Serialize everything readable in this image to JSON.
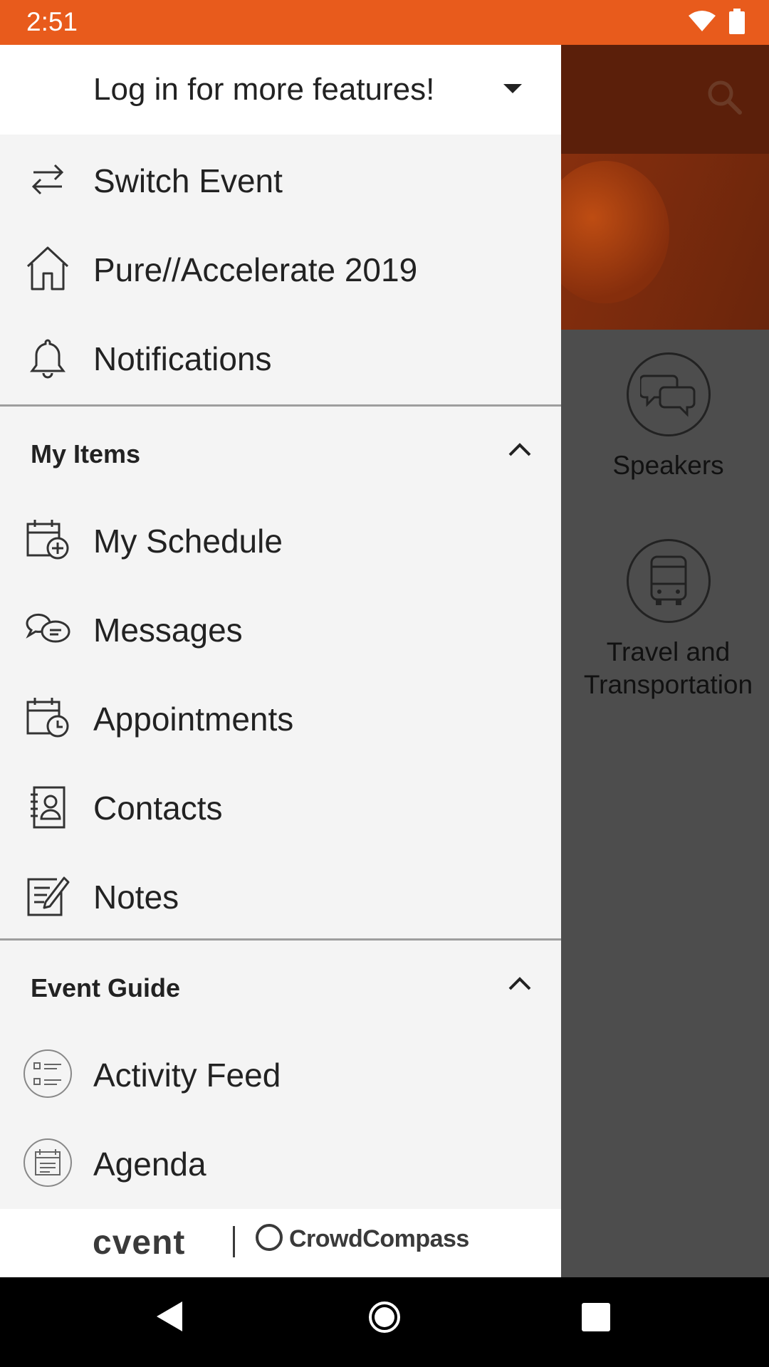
{
  "status_bar": {
    "time": "2:51"
  },
  "drawer": {
    "header_title": "Log in for more features!",
    "top_items": [
      {
        "label": "Switch Event",
        "icon": "switch-arrows-icon"
      },
      {
        "label": "Pure//Accelerate 2019",
        "icon": "home-icon"
      },
      {
        "label": "Notifications",
        "icon": "bell-icon"
      }
    ],
    "sections": [
      {
        "title": "My Items",
        "items": [
          {
            "label": "My Schedule",
            "icon": "calendar-add-icon"
          },
          {
            "label": "Messages",
            "icon": "chat-bubbles-icon"
          },
          {
            "label": "Appointments",
            "icon": "calendar-clock-icon"
          },
          {
            "label": "Contacts",
            "icon": "contact-book-icon"
          },
          {
            "label": "Notes",
            "icon": "notepad-pencil-icon"
          }
        ]
      },
      {
        "title": "Event Guide",
        "items": [
          {
            "label": "Activity Feed",
            "icon": "list-icon"
          },
          {
            "label": "Agenda",
            "icon": "agenda-icon"
          }
        ]
      }
    ],
    "footer": {
      "brand_left": "cvent",
      "brand_right": "CrowdCompass"
    }
  },
  "background": {
    "tiles": [
      {
        "label": "Speakers",
        "icon": "speech-bubbles-icon"
      },
      {
        "label": "Travel and Transportation",
        "icon": "bus-icon"
      }
    ]
  },
  "colors": {
    "accent": "#e85b1c",
    "drawer_bg": "#f4f4f4",
    "scrim": "#4d4d4d"
  }
}
